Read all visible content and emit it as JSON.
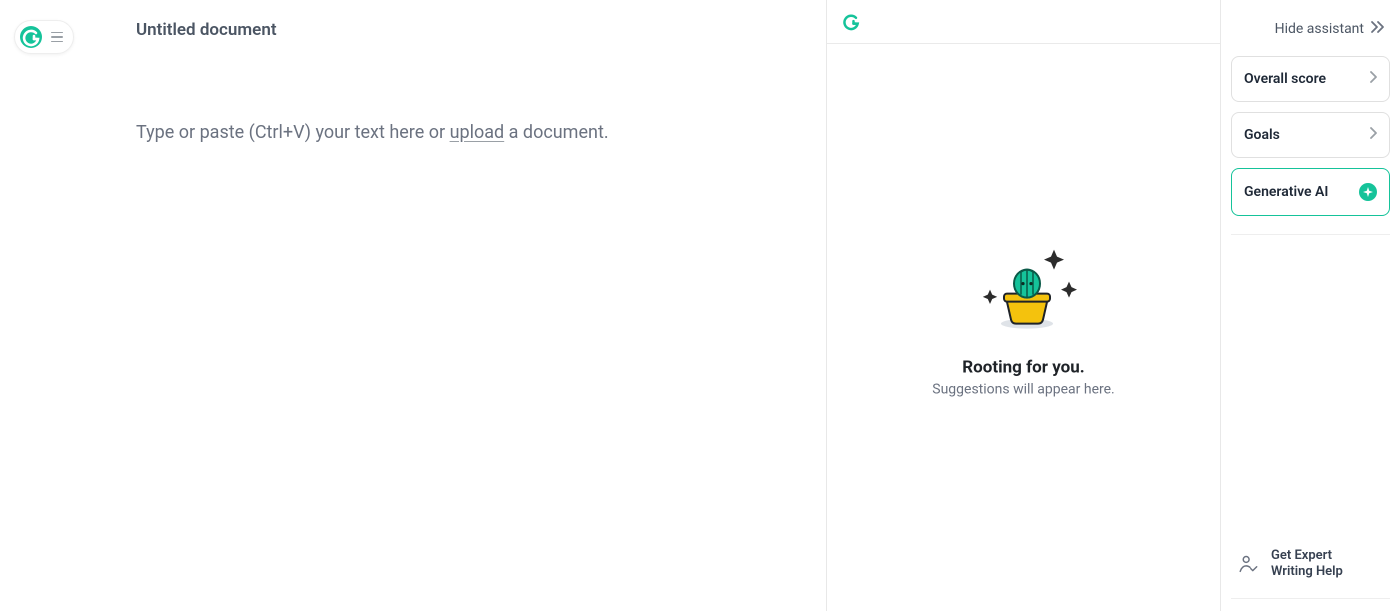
{
  "document": {
    "title": "Untitled document",
    "placeholder_pre": "Type or paste (Ctrl+V) your text here or ",
    "upload_label": "upload",
    "placeholder_post": " a document."
  },
  "suggestions": {
    "title": "Rooting for you.",
    "subtitle": "Suggestions will appear here."
  },
  "rail": {
    "hide_label": "Hide assistant",
    "overall_score": "Overall score",
    "goals": "Goals",
    "gen_ai": "Generative AI",
    "expert_line1": "Get Expert",
    "expert_line2": "Writing Help"
  }
}
